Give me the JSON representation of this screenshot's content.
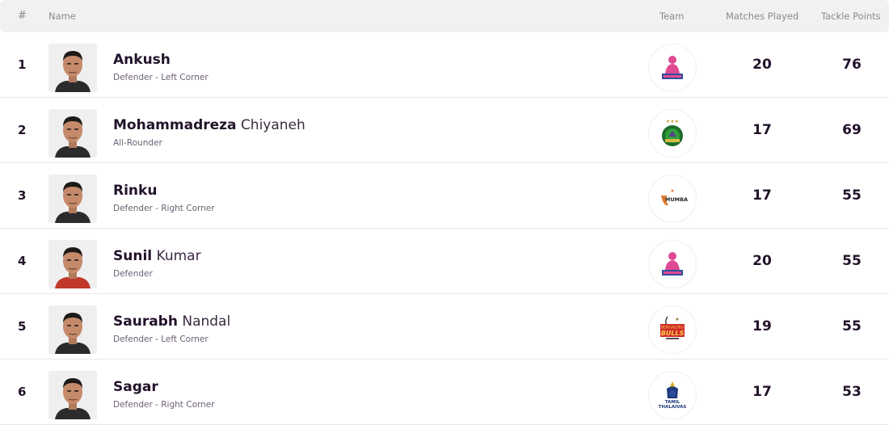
{
  "header": {
    "rank": "#",
    "name": "Name",
    "team": "Team",
    "matches": "Matches Played",
    "tackle": "Tackle Points"
  },
  "players": [
    {
      "rank": "1",
      "first": "Ankush",
      "last": "",
      "position": "Defender - Left Corner",
      "team": "Jaipur Pink Panthers",
      "team_icon": "jaipur-pink-panthers-logo",
      "matches": "20",
      "tackle_points": "76",
      "jersey_color": "#2b2b2b"
    },
    {
      "rank": "2",
      "first": "Mohammadreza",
      "last": "Chiyaneh",
      "position": "All-Rounder",
      "team": "Patna Pirates",
      "team_icon": "patna-pirates-logo",
      "matches": "17",
      "tackle_points": "69",
      "jersey_color": "#2b2b2b"
    },
    {
      "rank": "3",
      "first": "Rinku",
      "last": "",
      "position": "Defender - Right Corner",
      "team": "U Mumba",
      "team_icon": "u-mumba-logo",
      "matches": "17",
      "tackle_points": "55",
      "jersey_color": "#2b2b2b"
    },
    {
      "rank": "4",
      "first": "Sunil",
      "last": "Kumar",
      "position": "Defender",
      "team": "Jaipur Pink Panthers",
      "team_icon": "jaipur-pink-panthers-logo",
      "matches": "20",
      "tackle_points": "55",
      "jersey_color": "#c0392b"
    },
    {
      "rank": "5",
      "first": "Saurabh",
      "last": "Nandal",
      "position": "Defender - Left Corner",
      "team": "Bengaluru Bulls",
      "team_icon": "bengaluru-bulls-logo",
      "matches": "19",
      "tackle_points": "55",
      "jersey_color": "#2b2b2b"
    },
    {
      "rank": "6",
      "first": "Sagar",
      "last": "",
      "position": "Defender - Right Corner",
      "team": "Tamil Thalaivas",
      "team_icon": "tamil-thalaivas-logo",
      "matches": "17",
      "tackle_points": "53",
      "jersey_color": "#2b2b2b"
    }
  ]
}
